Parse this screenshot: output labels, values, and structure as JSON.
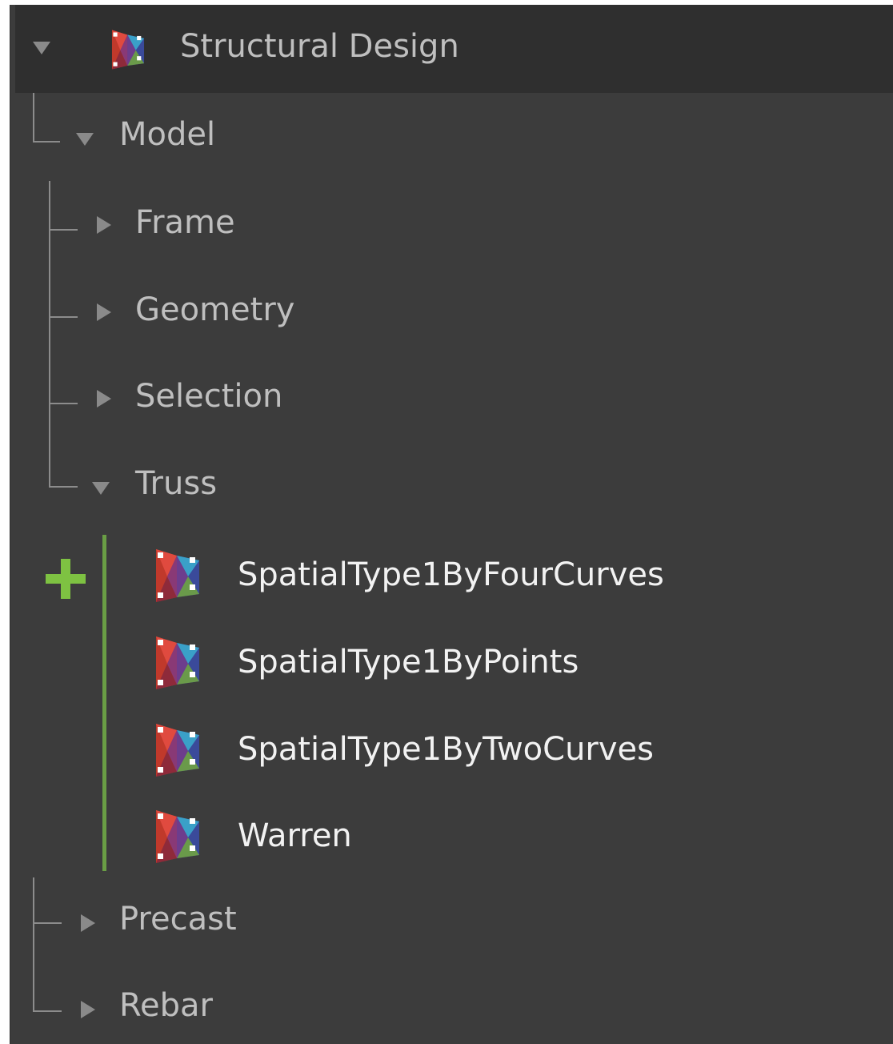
{
  "tree": {
    "root": {
      "label": "Structural Design",
      "icon": "package-icon",
      "expanded": true
    },
    "model": {
      "label": "Model",
      "expanded": true,
      "children": [
        {
          "label": "Frame",
          "expanded": false
        },
        {
          "label": "Geometry",
          "expanded": false
        },
        {
          "label": "Selection",
          "expanded": false
        },
        {
          "label": "Truss",
          "expanded": true
        }
      ]
    },
    "truss_nodes": [
      {
        "label": "SpatialType1ByFourCurves",
        "icon": "node-icon"
      },
      {
        "label": "SpatialType1ByPoints",
        "icon": "node-icon"
      },
      {
        "label": "SpatialType1ByTwoCurves",
        "icon": "node-icon"
      },
      {
        "label": "Warren",
        "icon": "node-icon"
      }
    ],
    "other_categories": [
      {
        "label": "Precast",
        "expanded": false
      },
      {
        "label": "Rebar",
        "expanded": false
      }
    ]
  },
  "colors": {
    "panel_bg": "#3c3c3c",
    "header_bg": "#2f2f2f",
    "accent_green": "#7ec242",
    "selection_line": "#6a9e45",
    "tree_line": "#8c8c8c",
    "category_text": "#bfbfbf",
    "node_text": "#f2f2f2"
  }
}
